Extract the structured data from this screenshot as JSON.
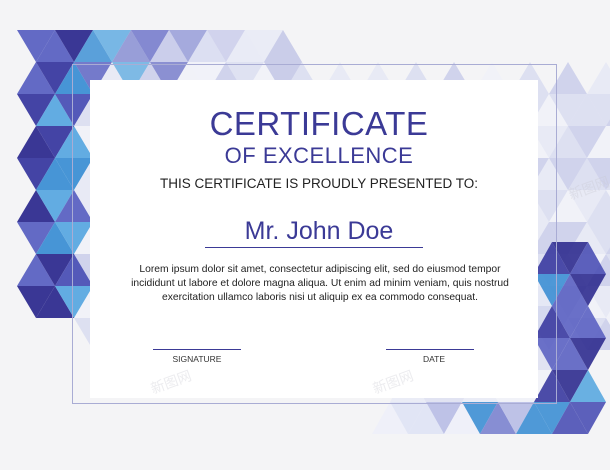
{
  "certificate": {
    "title": "CERTIFICATE",
    "subtitle": "OF EXCELLENCE",
    "presented_to": "THIS CERTIFICATE IS PROUDLY PRESENTED TO:",
    "recipient": "Mr. John Doe",
    "body": "Lorem ipsum dolor sit amet, consectetur adipiscing elit, sed do eiusmod tempor incididunt ut labore et dolore magna aliqua. Ut enim ad minim veniam, quis nostrud exercitation ullamco laboris nisi ut aliquip ex ea commodo consequat.",
    "signature_label": "SIGNATURE",
    "date_label": "DATE"
  },
  "watermark": "新图网",
  "colors": {
    "accent": "#3b3a96",
    "palette": [
      "#2f2c8f",
      "#3a3aa0",
      "#4b50b5",
      "#5b62c2",
      "#3d8fd4",
      "#5aa8e0",
      "#7b83cf",
      "#9aa0db",
      "#b8bce6",
      "#cdd2ee",
      "#dfe3f5",
      "#eef0fa",
      "#c7e6f5"
    ]
  }
}
